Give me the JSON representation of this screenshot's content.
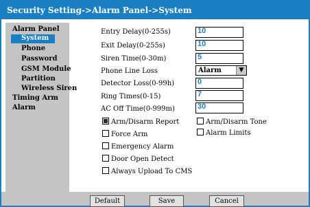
{
  "title": "Security Setting->Alarm Panel->System",
  "sidebar": {
    "items": [
      {
        "label": "Alarm Panel"
      },
      {
        "label": "System"
      },
      {
        "label": "Phone"
      },
      {
        "label": "Password"
      },
      {
        "label": "GSM Module"
      },
      {
        "label": "Partition"
      },
      {
        "label": "Wireless Siren"
      },
      {
        "label": "Timing Arm"
      },
      {
        "label": "Alarm"
      }
    ],
    "selected": "System"
  },
  "form": {
    "entry_delay": {
      "label": "Entry Delay(0-255s)",
      "value": "10"
    },
    "exit_delay": {
      "label": "Exit Delay(0-255s)",
      "value": "10"
    },
    "siren_time": {
      "label": "Siren Time(0-30m)",
      "value": "5"
    },
    "phone_line_loss": {
      "label": "Phone Line Loss",
      "value": "Alarm"
    },
    "detector_loss": {
      "label": "Detector Loss(0-99h)",
      "value": "0"
    },
    "ring_times": {
      "label": "Ring Times(0-15)",
      "value": "7"
    },
    "ac_off_time": {
      "label": "AC Off Time(0-999m)",
      "value": "30"
    }
  },
  "options": [
    {
      "label": "Arm/Disarm Report",
      "checked": true
    },
    {
      "label": "Arm/Disarm Tone",
      "checked": false
    },
    {
      "label": "Force Arm",
      "checked": false
    },
    {
      "label": "Alarm Limits",
      "checked": false
    },
    {
      "label": "Emergency Alarm",
      "checked": false
    },
    {
      "label": "Door Open Detect",
      "checked": false
    },
    {
      "label": "Always Upload To CMS",
      "checked": false
    }
  ],
  "buttons": {
    "default": "Default",
    "save": "Save",
    "cancel": "Cancel"
  },
  "colors": {
    "accent": "#1a7fc2",
    "panel": "#c4c4c4"
  },
  "icons": {
    "dropdown": "chevron-down-icon"
  }
}
